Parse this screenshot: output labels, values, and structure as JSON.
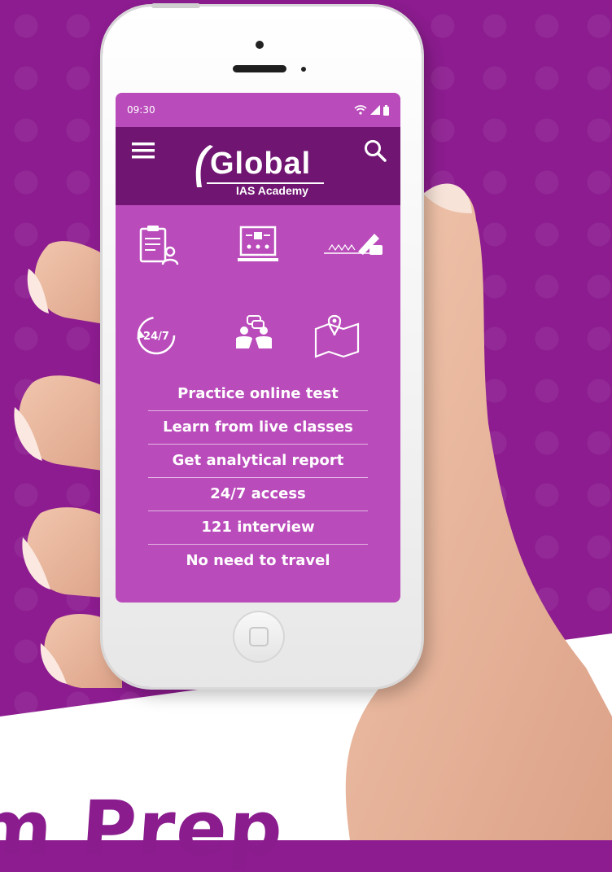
{
  "status_bar": {
    "time": "09:30"
  },
  "app_bar": {
    "brand_name": "Global",
    "brand_subtitle": "IAS Academy"
  },
  "feature_icons": [
    "test-clipboard-icon",
    "live-class-icon",
    "analytical-writing-icon",
    "24-7-access-icon",
    "interview-icon",
    "map-location-icon"
  ],
  "features": [
    "Practice online test",
    "Learn from live classes",
    "Get analytical report",
    "24/7 access",
    "121 interview",
    "No need to travel"
  ],
  "clock_badge": "24/7",
  "headline_fragment": "m Prep",
  "colors": {
    "background": "#8c1c8f",
    "app_bar": "#701572",
    "screen": "#b94bba",
    "headline": "#8a1c8e"
  }
}
